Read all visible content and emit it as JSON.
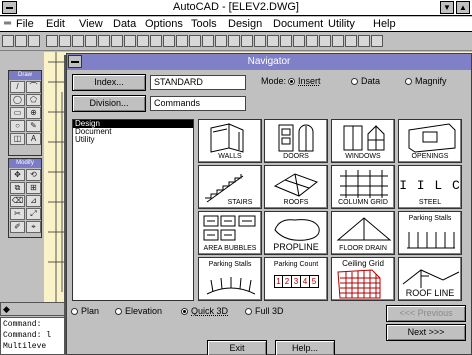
{
  "app": {
    "title": "AutoCAD - [ELEV2.DWG]",
    "menus": [
      "File",
      "Edit",
      "View",
      "Data",
      "Options",
      "Tools",
      "Design",
      "Document",
      "Utility",
      "Help"
    ],
    "window_buttons": [
      "▼",
      "▲"
    ]
  },
  "palettes": {
    "draw_title": "Draw",
    "modify_title": "Modify",
    "draw_glyphs": [
      "/",
      "⌒",
      "◯",
      "⬠",
      "▭",
      "⊕",
      "○",
      "✎",
      "◫",
      "A"
    ],
    "modify_glyphs": [
      "✥",
      "⟲",
      "⧉",
      "⊞",
      "⌫",
      "⊿",
      "✂",
      "⤢",
      "✐",
      "⌖"
    ]
  },
  "command": {
    "scroll_arrow": "◆",
    "lines": [
      "Command:",
      "Command: l",
      "Multileve"
    ]
  },
  "dialog": {
    "title": "Navigator",
    "index_button": "Index...",
    "index_value": "STANDARD",
    "division_button": "Division...",
    "division_value": "Commands",
    "mode_label": "Mode:",
    "modes": [
      {
        "label": "Insert",
        "selected": true
      },
      {
        "label": "Data",
        "selected": false
      },
      {
        "label": "Magnify",
        "selected": false
      }
    ],
    "list_items": [
      "Design",
      "Document",
      "Utility"
    ],
    "selected_list_item": "Design",
    "icons": [
      {
        "label": "WALLS",
        "name": "walls"
      },
      {
        "label": "DOORS",
        "name": "doors"
      },
      {
        "label": "WINDOWS",
        "name": "windows"
      },
      {
        "label": "OPENINGS",
        "name": "openings"
      },
      {
        "label": "STAIRS",
        "name": "stairs"
      },
      {
        "label": "ROOFS",
        "name": "roofs"
      },
      {
        "label": "COLUMN GRID",
        "name": "column-grid"
      },
      {
        "label": "STEEL",
        "name": "steel"
      },
      {
        "label": "AREA BUBBLES",
        "name": "area-bubbles"
      },
      {
        "label": "PROPLINE",
        "name": "propline"
      },
      {
        "label": "FLOOR DRAIN",
        "name": "floor-drain"
      },
      {
        "label": "Parking Stalls",
        "name": "parking-stalls"
      },
      {
        "label": "Parking Stalls",
        "name": "parking-stalls-curved"
      },
      {
        "label": "Parking Count",
        "name": "parking-count"
      },
      {
        "label": "Ceiling Grid",
        "name": "ceiling-grid"
      },
      {
        "label": "ROOF LINE",
        "name": "roof-line"
      }
    ],
    "steel_glyphs": "I I L C",
    "parking_count_numbers": [
      "1",
      "2",
      "3",
      "4",
      "5"
    ],
    "views": [
      {
        "label": "Plan",
        "selected": false
      },
      {
        "label": "Elevation",
        "selected": false
      },
      {
        "label": "Quick 3D",
        "selected": true
      },
      {
        "label": "Full 3D",
        "selected": false
      }
    ],
    "previous_button": "<<< Previous",
    "next_button": "Next >>>",
    "exit_button": "Exit",
    "help_button": "Help..."
  }
}
